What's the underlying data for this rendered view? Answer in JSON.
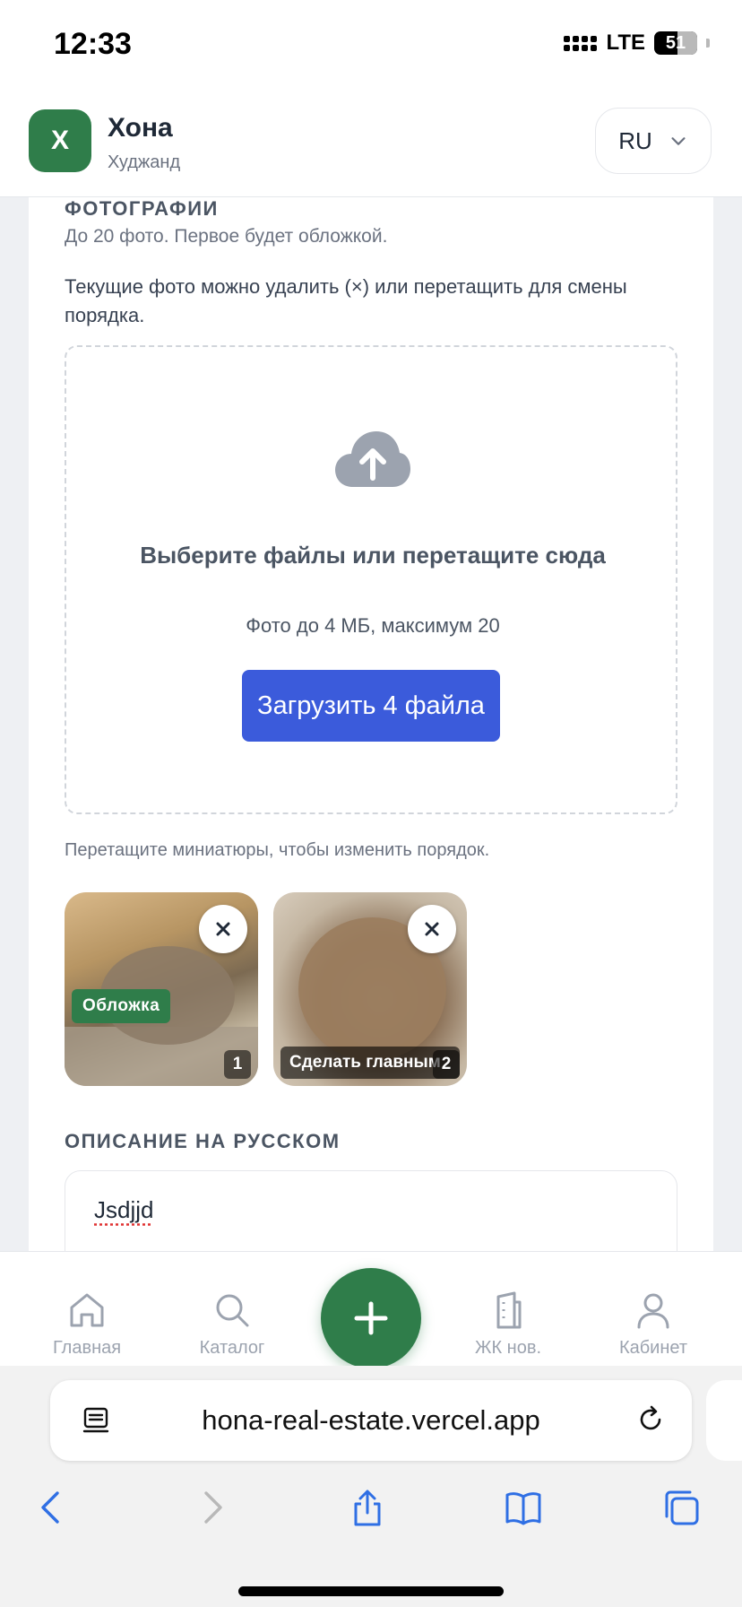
{
  "status": {
    "time": "12:33",
    "network": "LTE",
    "battery": "51"
  },
  "header": {
    "logo_letter": "Х",
    "brand": "Хона",
    "city": "Худжанд",
    "language": "RU"
  },
  "photos": {
    "title": "ФОТОГРАФИИ",
    "hint": "До 20 фото. Первое будет обложкой.",
    "note": "Текущие фото можно удалить (×) или перетащить для смены порядка.",
    "dropzone": {
      "title": "Выберите файлы или перетащите сюда",
      "subtitle": "Фото до 4 МБ, максимум 20",
      "button": "Загрузить 4 файла"
    },
    "reorder_hint": "Перетащите миниатюры, чтобы изменить порядок.",
    "thumbnails": [
      {
        "badge": "Обложка",
        "number": "1"
      },
      {
        "action": "Сделать главным",
        "number": "2"
      }
    ],
    "remove_symbol": "×"
  },
  "description": {
    "label": "ОПИСАНИЕ НА РУССКОМ",
    "value": "Jsdjjd"
  },
  "nav": {
    "items": [
      {
        "label": "Главная",
        "icon": "home-icon"
      },
      {
        "label": "Каталог",
        "icon": "search-icon"
      },
      {
        "label": "ЖК нов.",
        "icon": "building-icon"
      },
      {
        "label": "Кабинет",
        "icon": "user-icon"
      }
    ],
    "fab_icon": "plus-icon"
  },
  "browser": {
    "url": "hona-real-estate.vercel.app"
  },
  "colors": {
    "brand_green": "#2f7d4a",
    "primary_blue": "#3b5bdb"
  }
}
